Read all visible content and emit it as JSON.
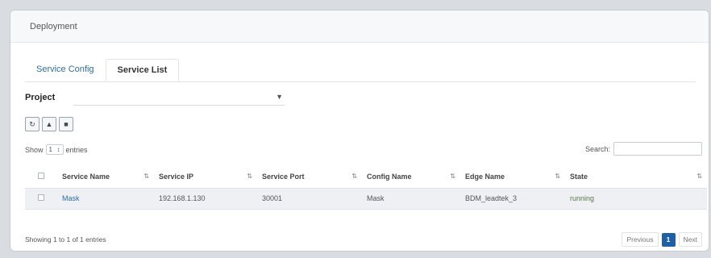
{
  "card": {
    "title": "Deployment"
  },
  "tabs": [
    {
      "label": "Service Config"
    },
    {
      "label": "Service List"
    }
  ],
  "project": {
    "label": "Project",
    "value": ""
  },
  "toolbar": {
    "refresh_icon": "refresh-icon",
    "upload_icon": "upload-icon",
    "delete_icon": "trash-icon"
  },
  "length": {
    "prefix": "Show",
    "value": "1",
    "suffix": "entries"
  },
  "search": {
    "label": "Search:",
    "value": ""
  },
  "table": {
    "columns": [
      "Service Name",
      "Service IP",
      "Service Port",
      "Config Name",
      "Edge Name",
      "State"
    ],
    "rows": [
      {
        "service_name": "Mask",
        "service_ip": "192.168.1.130",
        "service_port": "30001",
        "config_name": "Mask",
        "edge_name": "BDM_leadtek_3",
        "state": "running"
      }
    ]
  },
  "footer": {
    "info": "Showing 1 to 1 of 1 entries",
    "previous": "Previous",
    "current_page": "1",
    "next": "Next"
  },
  "colors": {
    "accent": "#1f5fa8",
    "link": "#2b6ea8"
  }
}
